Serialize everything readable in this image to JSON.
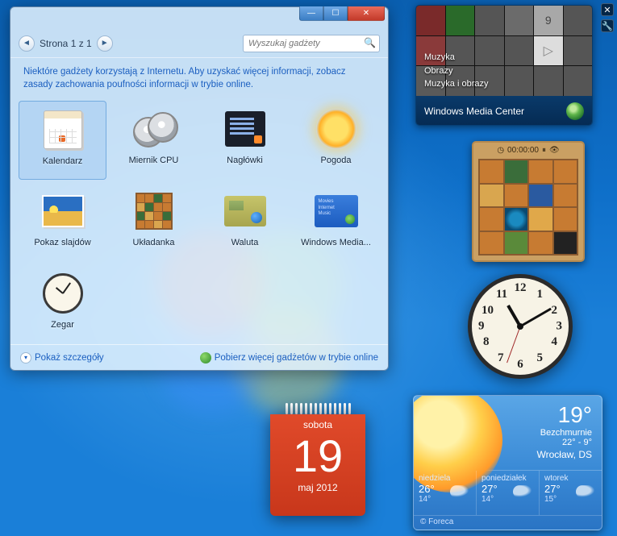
{
  "gallery": {
    "page_label": "Strona 1 z 1",
    "search_placeholder": "Wyszukaj gadżety",
    "info_text": "Niektóre gadżety korzystają z Internetu. Aby uzyskać więcej informacji, zobacz ",
    "info_link": "zasady zachowania poufności informacji w trybie online.",
    "details_label": "Pokaż szczegóły",
    "more_label": "Pobierz więcej gadżetów w trybie online",
    "items": [
      {
        "label": "Kalendarz"
      },
      {
        "label": "Miernik CPU"
      },
      {
        "label": "Nagłówki"
      },
      {
        "label": "Pogoda"
      },
      {
        "label": "Pokaz slajdów"
      },
      {
        "label": "Układanka"
      },
      {
        "label": "Waluta"
      },
      {
        "label": "Windows Media..."
      },
      {
        "label": "Zegar"
      }
    ]
  },
  "wmc": {
    "labels": [
      "Muzyka",
      "Obrazy",
      "Muzyka i obrazy"
    ],
    "footer": "Windows Media Center"
  },
  "puzzle": {
    "timer": "00:00:00"
  },
  "clock": {
    "n12": "12",
    "n1": "1",
    "n2": "2",
    "n3": "3",
    "n4": "4",
    "n5": "5",
    "n6": "6",
    "n7": "7",
    "n8": "8",
    "n9": "9",
    "n10": "10",
    "n11": "11"
  },
  "calendar": {
    "dow": "sobota",
    "day": "19",
    "monthyear": "maj 2012"
  },
  "weather": {
    "temp": "19°",
    "cond": "Bezchmurnie",
    "range_hi": "22°",
    "range_lo": "9°",
    "range_sep": " - ",
    "location": "Wrocław, DS",
    "forecast": [
      {
        "d": "niedziela",
        "hi": "26°",
        "lo": "14°"
      },
      {
        "d": "poniedziałek",
        "hi": "27°",
        "lo": "14°"
      },
      {
        "d": "wtorek",
        "hi": "27°",
        "lo": "15°"
      }
    ],
    "credit": "© Foreca"
  }
}
